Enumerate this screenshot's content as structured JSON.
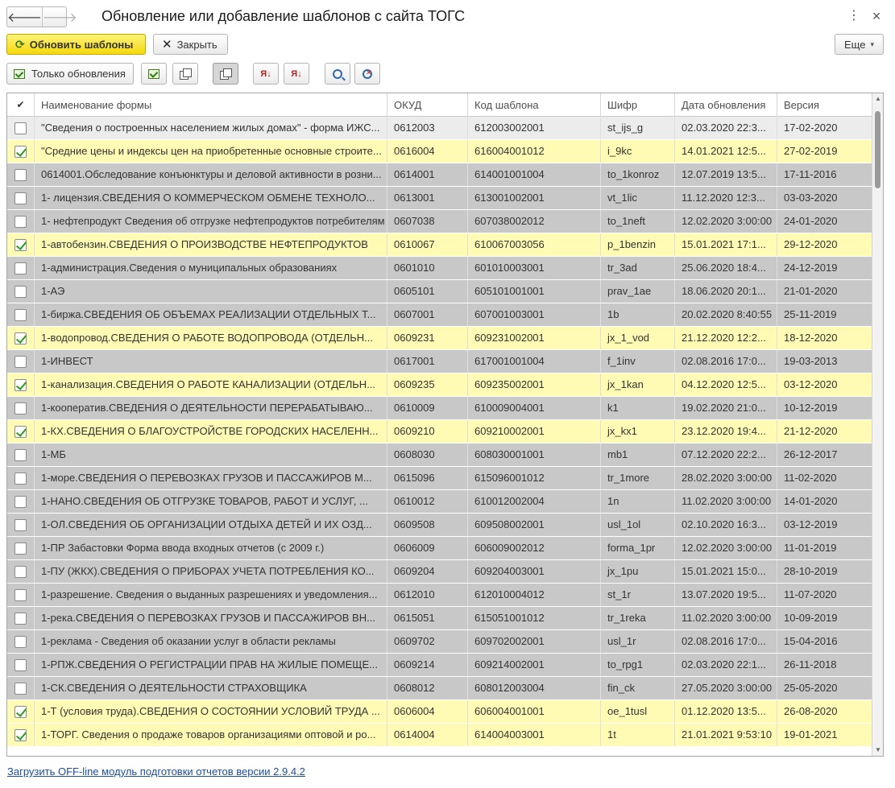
{
  "window": {
    "title": "Обновление или добавление шаблонов с сайта ТОГС",
    "menu_glyph": "⋮",
    "close_glyph": "×",
    "back_glyph": "🡐",
    "forward_glyph": "🡒"
  },
  "commands": {
    "update_label": "Обновить шаблоны",
    "close_label": "Закрыть",
    "more_label": "Еще",
    "refresh_glyph": "⟳",
    "x_glyph": "✕",
    "caret_glyph": "▾"
  },
  "toolbar": {
    "only_updates_label": "Только обновления",
    "sort_asc_glyph": "Я↓",
    "sort_desc_glyph": "Я↓"
  },
  "table": {
    "columns": [
      "✔",
      "Наименование формы",
      "ОКУД",
      "Код шаблона",
      "Шифр",
      "Дата обновления",
      "Версия"
    ],
    "rows": [
      {
        "checked": false,
        "name": "\"Сведения о построенных населением жилых домах\" - форма ИЖС...",
        "okud": "0612003",
        "code": "612003002001",
        "cipher": "st_ijs_g",
        "date": "02.03.2020 22:3...",
        "version": "17-02-2020"
      },
      {
        "checked": true,
        "name": "\"Средние цены и индексы цен на приобретенные основные строите...",
        "okud": "0616004",
        "code": "616004001012",
        "cipher": "i_9kc",
        "date": "14.01.2021 12:5...",
        "version": "27-02-2019"
      },
      {
        "checked": false,
        "name": "0614001.Обследование конъюнктуры и деловой активности в розни...",
        "okud": "0614001",
        "code": "614001001004",
        "cipher": "to_1konroz",
        "date": "12.07.2019 13:5...",
        "version": "17-11-2016"
      },
      {
        "checked": false,
        "name": "1- лицензия.СВЕДЕНИЯ О КОММЕРЧЕСКОМ ОБМЕНЕ ТЕХНОЛО...",
        "okud": "0613001",
        "code": "613001002001",
        "cipher": "vt_1lic",
        "date": "11.12.2020 12:3...",
        "version": "03-03-2020"
      },
      {
        "checked": false,
        "name": "1- нефтепродукт Сведения об отгрузке нефтепродуктов потребителям",
        "okud": "0607038",
        "code": "607038002012",
        "cipher": "to_1neft",
        "date": "12.02.2020 3:00:00",
        "version": "24-01-2020"
      },
      {
        "checked": true,
        "name": "1-автобензин.СВЕДЕНИЯ О ПРОИЗВОДСТВЕ НЕФТЕПРОДУКТОВ",
        "okud": "0610067",
        "code": "610067003056",
        "cipher": "p_1benzin",
        "date": "15.01.2021 17:1...",
        "version": "29-12-2020"
      },
      {
        "checked": false,
        "name": "1-администрация.Сведения о муниципальных образованиях",
        "okud": "0601010",
        "code": "601010003001",
        "cipher": "tr_3ad",
        "date": "25.06.2020 18:4...",
        "version": "24-12-2019"
      },
      {
        "checked": false,
        "name": "1-АЭ",
        "okud": "0605101",
        "code": "605101001001",
        "cipher": "prav_1ae",
        "date": "18.06.2020 20:1...",
        "version": "21-01-2020"
      },
      {
        "checked": false,
        "name": "1-биржа.СВЕДЕНИЯ ОБ ОБЪЕМАХ РЕАЛИЗАЦИИ ОТДЕЛЬНЫХ Т...",
        "okud": "0607001",
        "code": "607001003001",
        "cipher": "1b",
        "date": "20.02.2020 8:40:55",
        "version": "25-11-2019"
      },
      {
        "checked": true,
        "name": "1-водопровод.СВЕДЕНИЯ О РАБОТЕ ВОДОПРОВОДА (ОТДЕЛЬН...",
        "okud": "0609231",
        "code": "609231002001",
        "cipher": "jx_1_vod",
        "date": "21.12.2020 12:2...",
        "version": "18-12-2020"
      },
      {
        "checked": false,
        "name": "1-ИНВЕСТ",
        "okud": "0617001",
        "code": "617001001004",
        "cipher": "f_1inv",
        "date": "02.08.2016 17:0...",
        "version": "19-03-2013"
      },
      {
        "checked": true,
        "name": "1-канализация.СВЕДЕНИЯ О РАБОТЕ КАНАЛИЗАЦИИ (ОТДЕЛЬН...",
        "okud": "0609235",
        "code": "609235002001",
        "cipher": "jx_1kan",
        "date": "04.12.2020 12:5...",
        "version": "03-12-2020"
      },
      {
        "checked": false,
        "name": "1-кооператив.СВЕДЕНИЯ О ДЕЯТЕЛЬНОСТИ ПЕРЕРАБАТЫВАЮ...",
        "okud": "0610009",
        "code": "610009004001",
        "cipher": "k1",
        "date": "19.02.2020 21:0...",
        "version": "10-12-2019"
      },
      {
        "checked": true,
        "name": "1-КХ.СВЕДЕНИЯ О БЛАГОУСТРОЙСТВЕ ГОРОДСКИХ НАСЕЛЕНН...",
        "okud": "0609210",
        "code": "609210002001",
        "cipher": "jx_kx1",
        "date": "23.12.2020 19:4...",
        "version": "21-12-2020"
      },
      {
        "checked": false,
        "name": "1-МБ",
        "okud": "0608030",
        "code": "608030001001",
        "cipher": "mb1",
        "date": "07.12.2020 22:2...",
        "version": "26-12-2017"
      },
      {
        "checked": false,
        "name": "1-море.СВЕДЕНИЯ  О ПЕРЕВОЗКАХ ГРУЗОВ И ПАССАЖИРОВ М...",
        "okud": "0615096",
        "code": "615096001012",
        "cipher": "tr_1more",
        "date": "28.02.2020 3:00:00",
        "version": "11-02-2020"
      },
      {
        "checked": false,
        "name": "1-НАНО.СВЕДЕНИЯ ОБ ОТГРУЗКЕ ТОВАРОВ, РАБОТ И УСЛУГ, ...",
        "okud": "0610012",
        "code": "610012002004",
        "cipher": "1n",
        "date": "11.02.2020 3:00:00",
        "version": "14-01-2020"
      },
      {
        "checked": false,
        "name": "1-ОЛ.СВЕДЕНИЯ ОБ ОРГАНИЗАЦИИ ОТДЫХА ДЕТЕЙ И ИХ ОЗД...",
        "okud": "0609508",
        "code": "609508002001",
        "cipher": "usl_1ol",
        "date": "02.10.2020 16:3...",
        "version": "03-12-2019"
      },
      {
        "checked": false,
        "name": "1-ПР Забастовки Форма ввода входных отчетов (с 2009 г.)",
        "okud": "0606009",
        "code": "606009002012",
        "cipher": "forma_1pr",
        "date": "12.02.2020 3:00:00",
        "version": "11-01-2019"
      },
      {
        "checked": false,
        "name": "1-ПУ (ЖКХ).СВЕДЕНИЯ О ПРИБОРАХ УЧЕТА ПОТРЕБЛЕНИЯ КО...",
        "okud": "0609204",
        "code": "609204003001",
        "cipher": "jx_1pu",
        "date": "15.01.2021 15:0...",
        "version": "28-10-2019"
      },
      {
        "checked": false,
        "name": "1-разрешение. Сведения о выданных разрешениях и уведомления...",
        "okud": "0612010",
        "code": "612010004012",
        "cipher": "st_1r",
        "date": "13.07.2020 19:5...",
        "version": "11-07-2020"
      },
      {
        "checked": false,
        "name": "1-река.СВЕДЕНИЯ О ПЕРЕВОЗКАХ ГРУЗОВ И ПАССАЖИРОВ ВН...",
        "okud": "0615051",
        "code": "615051001012",
        "cipher": "tr_1reka",
        "date": "11.02.2020 3:00:00",
        "version": "10-09-2019"
      },
      {
        "checked": false,
        "name": "1-реклама - Сведения об оказании услуг в области рекламы",
        "okud": "0609702",
        "code": "609702002001",
        "cipher": "usl_1r",
        "date": "02.08.2016 17:0...",
        "version": "15-04-2016"
      },
      {
        "checked": false,
        "name": "1-РПЖ.СВЕДЕНИЯ О РЕГИСТРАЦИИ ПРАВ НА ЖИЛЫЕ ПОМЕЩЕ...",
        "okud": "0609214",
        "code": "609214002001",
        "cipher": "to_rpg1",
        "date": "02.03.2020 22:1...",
        "version": "26-11-2018"
      },
      {
        "checked": false,
        "name": "1-СК.СВЕДЕНИЯ О ДЕЯТЕЛЬНОСТИ СТРАХОВЩИКА",
        "okud": "0608012",
        "code": "608012003004",
        "cipher": "fin_ck",
        "date": "27.05.2020 3:00:00",
        "version": "25-05-2020"
      },
      {
        "checked": true,
        "name": "1-Т (условия труда).СВЕДЕНИЯ О СОСТОЯНИИ УСЛОВИЙ ТРУДА ...",
        "okud": "0606004",
        "code": "606004001001",
        "cipher": "oe_1tusl",
        "date": "01.12.2020 13:5...",
        "version": "26-08-2020"
      },
      {
        "checked": true,
        "name": "1-ТОРГ. Сведения о продаже товаров организациями оптовой и ро...",
        "okud": "0614004",
        "code": "614004003001",
        "cipher": "1t",
        "date": "21.01.2021 9:53:10",
        "version": "19-01-2021"
      }
    ]
  },
  "footer": {
    "link_label": "Загрузить OFF-line модуль подготовки отчетов версии 2.9.4.2"
  },
  "scrollbar": {
    "up_glyph": "▲",
    "down_glyph": "▼"
  },
  "colors": {
    "primary_button": "#f5d90c",
    "selected_row": "#fffbb4",
    "row": "#c8c8c8",
    "link": "#1b4f9c"
  }
}
